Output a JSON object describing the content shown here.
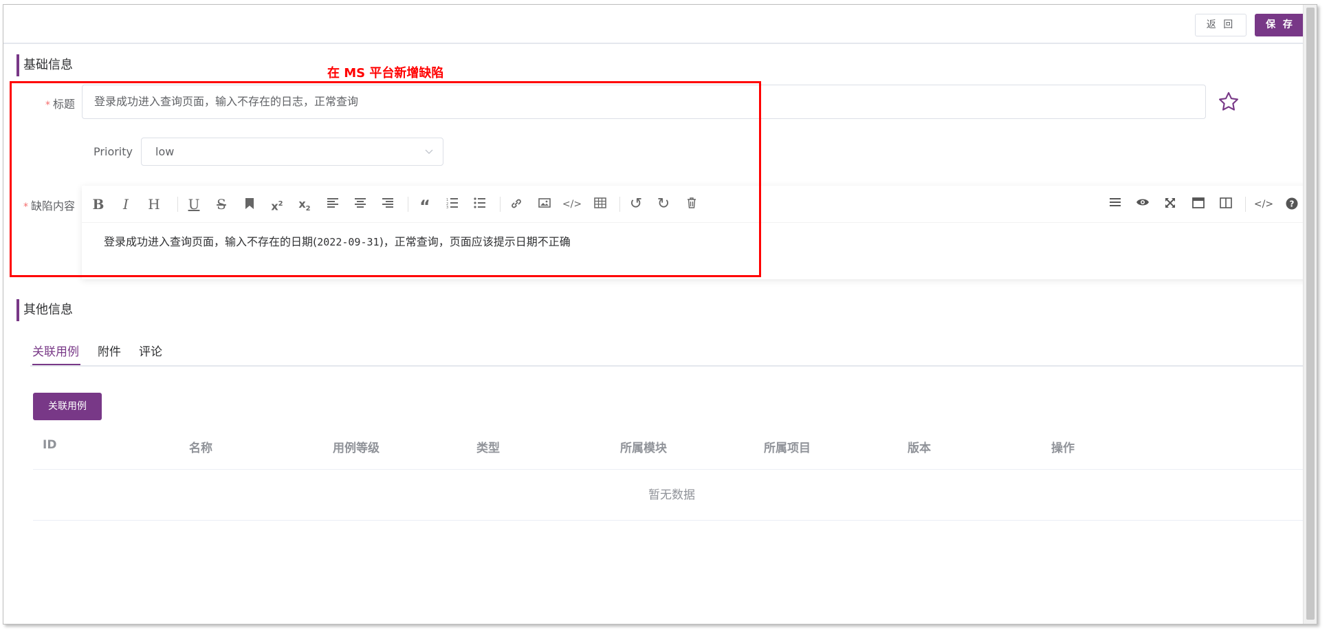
{
  "header": {
    "back_label": "返 回",
    "save_label": "保 存"
  },
  "annotation": "在 MS 平台新增缺陷",
  "basic_section": {
    "title": "基础信息",
    "required_mark": "*",
    "title_field": {
      "label": "标题",
      "value": "登录成功进入查询页面，输入不存在的日志，正常查询"
    },
    "priority_field": {
      "label": "Priority",
      "value": "low"
    },
    "content_field": {
      "label": "缺陷内容",
      "text_before": "登录成功进入查询页面，输入不存在的日期(",
      "text_code": "2022-09-31",
      "text_after": ")，正常查询，页面应该提示日期不正确"
    },
    "toolbar_left": [
      "bold-icon",
      "italic-icon",
      "heading-icon",
      "underline-icon",
      "strikethrough-icon",
      "bookmark-icon",
      "superscript-icon",
      "subscript-icon",
      "align-left-icon",
      "align-center-icon",
      "align-right-icon",
      "quote-icon",
      "ordered-list-icon",
      "unordered-list-icon",
      "link-icon",
      "image-icon",
      "code-icon",
      "table-icon",
      "undo-icon",
      "redo-icon",
      "trash-icon"
    ],
    "toolbar_right": [
      "menu-icon",
      "preview-icon",
      "fullscreen-icon",
      "window-icon",
      "split-view-icon",
      "html-icon",
      "help-icon"
    ]
  },
  "other_section": {
    "title": "其他信息",
    "tabs": [
      {
        "label": "关联用例",
        "active": true
      },
      {
        "label": "附件",
        "active": false
      },
      {
        "label": "评论",
        "active": false
      }
    ],
    "link_case_button": "关联用例",
    "table": {
      "columns": [
        "ID",
        "名称",
        "用例等级",
        "类型",
        "所属模块",
        "所属项目",
        "版本",
        "操作"
      ],
      "rows": [],
      "empty_text": "暂无数据"
    }
  },
  "colors": {
    "accent": "#783887",
    "annotation": "#ff0000",
    "required": "#f56c6c"
  }
}
